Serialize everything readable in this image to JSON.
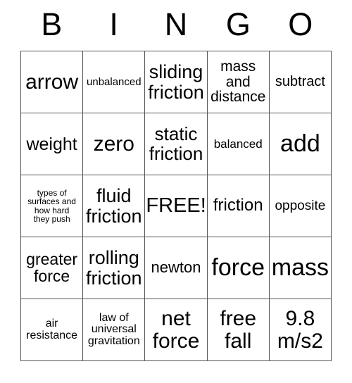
{
  "card": {
    "header_letters": [
      "B",
      "I",
      "N",
      "G",
      "O"
    ],
    "rows": [
      [
        {
          "text": "arrow",
          "size": "fs-30"
        },
        {
          "text": "unbalanced",
          "size": "fs-15"
        },
        {
          "text": "sliding\nfriction",
          "size": "fs-27"
        },
        {
          "text": "mass\nand\ndistance",
          "size": "fs-21"
        },
        {
          "text": "subtract",
          "size": "fs-20"
        }
      ],
      [
        {
          "text": "weight",
          "size": "fs-25"
        },
        {
          "text": "zero",
          "size": "fs-30"
        },
        {
          "text": "static\nfriction",
          "size": "fs-26"
        },
        {
          "text": "balanced",
          "size": "fs-17"
        },
        {
          "text": "add",
          "size": "fs-34"
        }
      ],
      [
        {
          "text": "types of\nsurfaces and\nhow hard\nthey push",
          "size": "fs-12"
        },
        {
          "text": "fluid\nfriction",
          "size": "fs-27"
        },
        {
          "text": "FREE!",
          "size": "fs-29"
        },
        {
          "text": "friction",
          "size": "fs-24"
        },
        {
          "text": "opposite",
          "size": "fs-19"
        }
      ],
      [
        {
          "text": "greater\nforce",
          "size": "fs-23"
        },
        {
          "text": "rolling\nfriction",
          "size": "fs-27"
        },
        {
          "text": "newton",
          "size": "fs-22"
        },
        {
          "text": "force",
          "size": "fs-34"
        },
        {
          "text": "mass",
          "size": "fs-34"
        }
      ],
      [
        {
          "text": "air\nresistance",
          "size": "fs-16"
        },
        {
          "text": "law of\nuniversal\ngravitation",
          "size": "fs-16"
        },
        {
          "text": "net\nforce",
          "size": "fs-30"
        },
        {
          "text": "free\nfall",
          "size": "fs-30"
        },
        {
          "text": "9.8\nm/s2",
          "size": "fs-30"
        }
      ]
    ]
  },
  "colors": {
    "background": "#ffffff",
    "text": "#000000",
    "border": "#555555"
  }
}
